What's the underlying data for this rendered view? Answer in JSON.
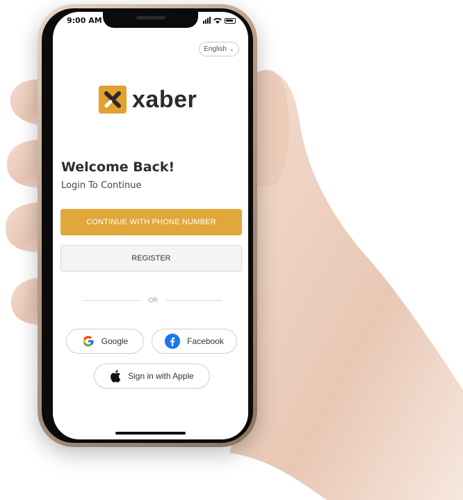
{
  "status_bar": {
    "time": "9:00 AM"
  },
  "language_selector": {
    "value": "English",
    "icon": "chevron-down-icon"
  },
  "logo": {
    "text": "xaber",
    "mark_color": "#e2a02f"
  },
  "welcome": {
    "title": "Welcome Back!",
    "subtitle": "Login To Continue"
  },
  "buttons": {
    "phone_label": "CONTINUE WITH PHONE NUMBER",
    "register_label": "REGISTER"
  },
  "divider": {
    "label": "OR"
  },
  "social": {
    "google_label": "Google",
    "facebook_label": "Facebook",
    "apple_label": "Sign in with Apple"
  },
  "colors": {
    "accent": "#e0a73b",
    "facebook": "#1877f2"
  }
}
